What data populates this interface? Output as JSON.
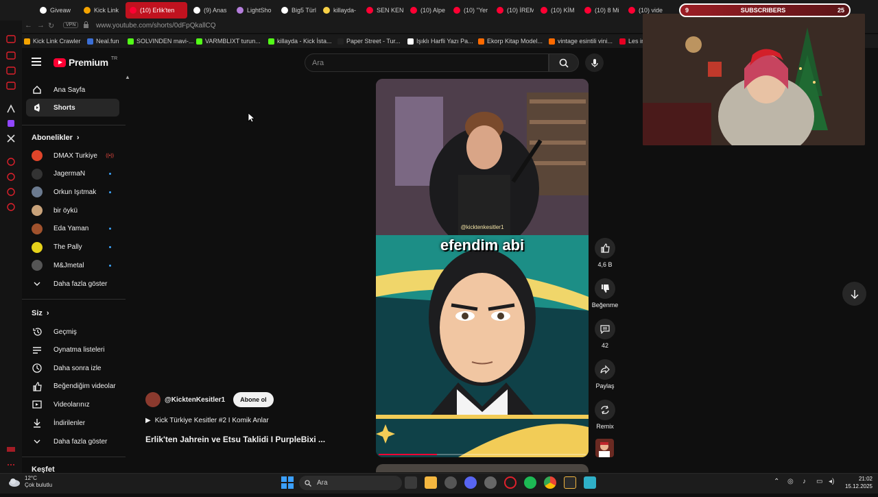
{
  "browser": {
    "tabs": [
      {
        "label": "Giveaw",
        "color": "#ffffff"
      },
      {
        "label": "Kick Link",
        "color": "#f4a300"
      },
      {
        "label": "(10) Erlik'ten",
        "color": "#ff0033",
        "active": true
      },
      {
        "label": "(9) Anas",
        "color": "#ffffff"
      },
      {
        "label": "LightSho",
        "color": "#b57edc"
      },
      {
        "label": "Big5 Türl",
        "color": "#ffffff"
      },
      {
        "label": "killayda-",
        "color": "#f7d046"
      },
      {
        "label": "SEN KEN",
        "color": "#ff0033"
      },
      {
        "label": "(10) Alpe",
        "color": "#ff0033"
      },
      {
        "label": "(10) ''Yer",
        "color": "#ff0033"
      },
      {
        "label": "(10) İREM",
        "color": "#ff0033"
      },
      {
        "label": "(10) KİM",
        "color": "#ff0033"
      },
      {
        "label": "(10) 8 Mi",
        "color": "#ff0033"
      },
      {
        "label": "(10) vide",
        "color": "#ff0033"
      }
    ],
    "vpn_label": "VPN",
    "url": "www.youtube.com/shorts/0dFpQkallCQ",
    "bookmarks": [
      {
        "label": "Kick Link Crawler",
        "color": "#f4a300"
      },
      {
        "label": "Neal.fun",
        "color": "#3b6fd6"
      },
      {
        "label": "SOLVINDEN mavi-...",
        "color": "#53fc18"
      },
      {
        "label": "VARMBLIXT turun...",
        "color": "#53fc18"
      },
      {
        "label": "killayda - Kick İsta...",
        "color": "#53fc18"
      },
      {
        "label": "Paper Street - Tur...",
        "color": "#222222"
      },
      {
        "label": "Işıklı Harfli Yazı Pa...",
        "color": "#ffffff"
      },
      {
        "label": "Ekorp Kitap Model...",
        "color": "#ff6a00"
      },
      {
        "label": "vintage esintili vini...",
        "color": "#ff6a00"
      },
      {
        "label": "Les in",
        "color": "#e60023"
      }
    ]
  },
  "header": {
    "logo_word": "Premium",
    "logo_region": "TR",
    "search_placeholder": "Ara"
  },
  "sidebar": {
    "main": [
      {
        "label": "Ana Sayfa",
        "icon": "home-icon"
      },
      {
        "label": "Shorts",
        "icon": "shorts-icon",
        "active": true
      }
    ],
    "subscriptions_heading": "Abonelikler",
    "subscriptions": [
      {
        "label": "DMAX Turkiye",
        "color": "#e0452a",
        "live": true
      },
      {
        "label": "JagermaN",
        "color": "#333333",
        "dot": true
      },
      {
        "label": "Orkun Işıtmak",
        "color": "#6b7a8f",
        "dot": true
      },
      {
        "label": "bir öykü",
        "color": "#c8a27a"
      },
      {
        "label": "Eda Yaman",
        "color": "#a0522d",
        "dot": true
      },
      {
        "label": "The Pally",
        "color": "#e6d21a",
        "dot": true
      },
      {
        "label": "M&Jmetal",
        "color": "#555555",
        "dot": true
      }
    ],
    "show_more": "Daha fazla göster",
    "you_heading": "Siz",
    "you_items": [
      {
        "label": "Geçmiş",
        "icon": "history-icon"
      },
      {
        "label": "Oynatma listeleri",
        "icon": "playlists-icon"
      },
      {
        "label": "Daha sonra izle",
        "icon": "watch-later-icon"
      },
      {
        "label": "Beğendiğim videolar",
        "icon": "liked-icon"
      },
      {
        "label": "Videolarınız",
        "icon": "your-videos-icon"
      },
      {
        "label": "İndirilenler",
        "icon": "downloads-icon"
      }
    ],
    "show_more_2": "Daha fazla göster",
    "explore_heading": "Keşfet"
  },
  "short": {
    "overlay_text": "efendim abi",
    "watermark": "@kicktenkesitler1",
    "progress": 0.28,
    "channel": "@KicktenKesitler1",
    "subscribe_label": "Abone ol",
    "playlist": "Kick Türkiye Kesitler #2 I Komik Anlar",
    "title": "Erlik'ten Jahrein ve Etsu Taklidi I PurpleBixi ...",
    "actions": {
      "like_count": "4,6 B",
      "dislike_label": "Beğenme",
      "comment_count": "42",
      "share_label": "Paylaş",
      "remix_label": "Remix"
    }
  },
  "stream_overlay": {
    "sub_count_left": "9",
    "sub_label": "SUBSCRIBERS",
    "sub_count_right": "25"
  },
  "taskbar": {
    "temperature": "12°C",
    "weather_desc": "Çok bulutlu",
    "search_label": "Ara",
    "time": "21:02",
    "date": "15.12.2025"
  }
}
